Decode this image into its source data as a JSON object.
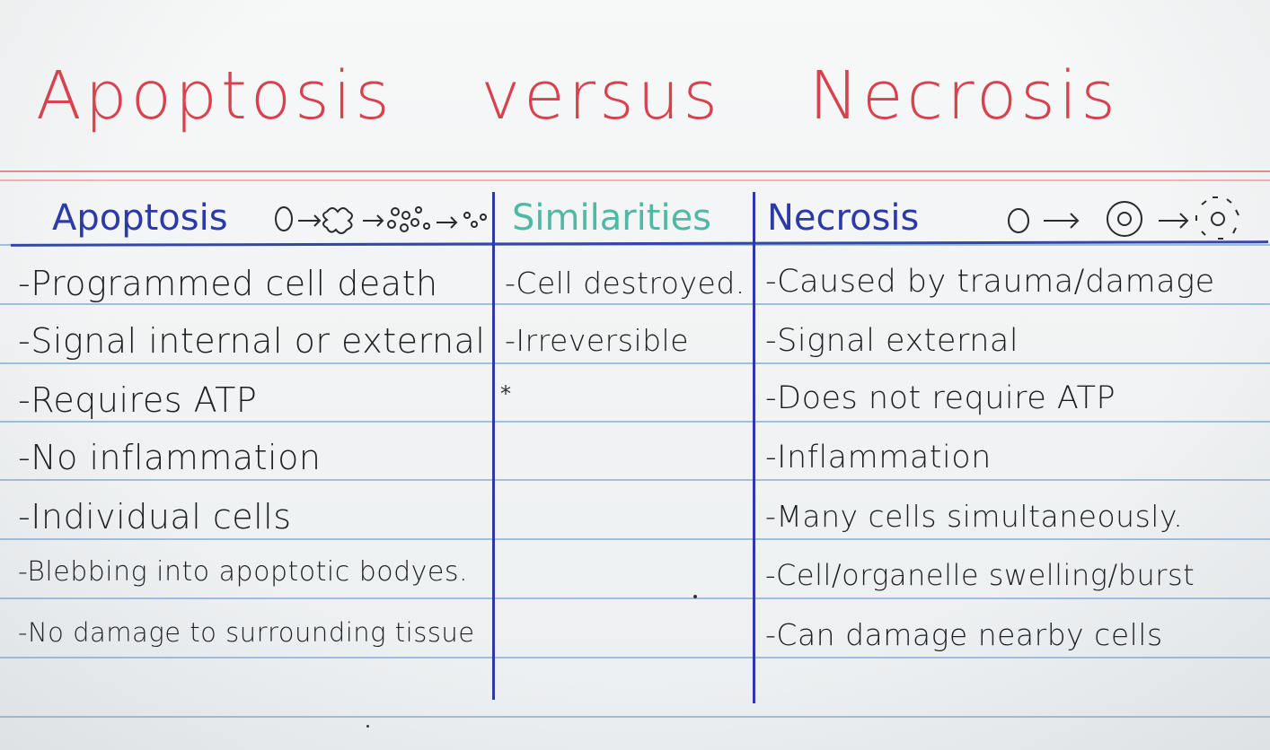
{
  "title": {
    "left": "Apoptosis",
    "middle": "versus",
    "right": "Necrosis"
  },
  "columns": {
    "apoptosis": {
      "heading": "Apoptosis",
      "items": [
        "-Programmed cell death",
        "-Signal internal or external",
        "-Requires ATP",
        "-No inflammation",
        "-Individual cells",
        "-Blebbing into apoptotic bodyes.",
        "-No damage to surrounding tissue"
      ]
    },
    "similarities": {
      "heading": "Similarities",
      "items": [
        "-Cell destroyed.",
        "-Irreversible"
      ]
    },
    "necrosis": {
      "heading": "Necrosis",
      "items": [
        "-Caused by trauma/damage",
        "-Signal external",
        "-Does not require ATP",
        "-Inflammation",
        "-Many cells simultaneously.",
        "-Cell/organelle swelling/burst",
        "-Can damage nearby cells"
      ]
    }
  },
  "marks": {
    "star": "*"
  },
  "colors": {
    "title": "#d8424e",
    "ink": "#2b3aa8",
    "similarities": "#4fb9a4",
    "rule": "#8fb6d8"
  }
}
